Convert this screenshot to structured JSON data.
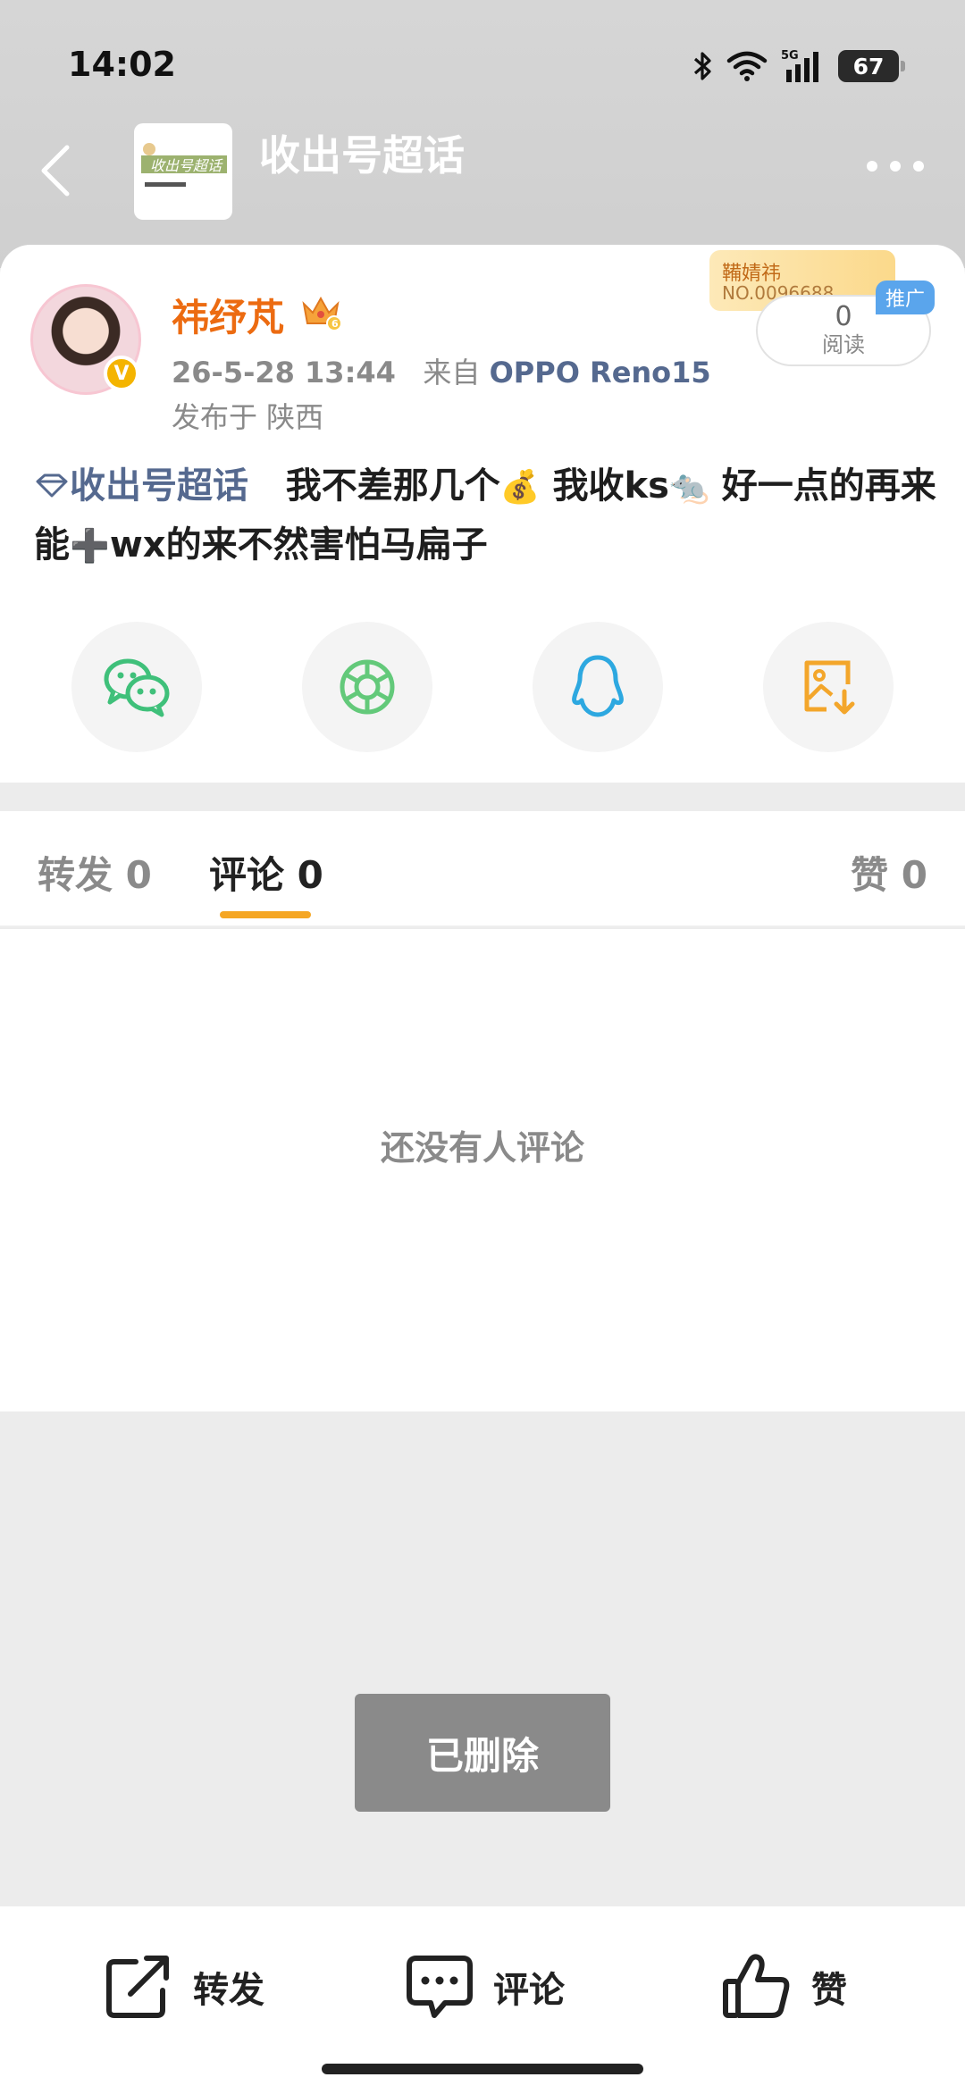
{
  "status_bar": {
    "time": "14:02",
    "network": "5G",
    "battery": "67"
  },
  "nav": {
    "topic_title": "收出号超话",
    "thumb_text": "收出号超话"
  },
  "post": {
    "username": "祎纾芃",
    "vip_level": "6",
    "time": "26-5-28 13:44",
    "source_prefix": "来自",
    "source": "OPPO Reno15",
    "location": "发布于 陕西",
    "promo_name": "鞴婧祎",
    "promo_no": "NO.0096688",
    "promo_tag": "推广",
    "read_count": "0",
    "read_label": "阅读",
    "topic_link": "收出号超话",
    "text_part1": "我不差那几个",
    "emoji1": "💰",
    "text_part2": "我收ks",
    "emoji2": "🐀",
    "text_part3": "好一点的再来 能",
    "emoji3": "➕",
    "text_part4": "wx的来不然害怕马扁子"
  },
  "share_icons": [
    "wechat-icon",
    "moments-icon",
    "qq-icon",
    "save-image-icon"
  ],
  "tabs": {
    "repost": "转发 0",
    "comment": "评论 0",
    "like": "赞 0"
  },
  "comments": {
    "empty": "还没有人评论"
  },
  "toast": "已删除",
  "bottom_bar": {
    "repost": "转发",
    "comment": "评论",
    "like": "赞"
  },
  "colors": {
    "accent": "#f5a623",
    "username": "#ec6b11",
    "link": "#55698f"
  }
}
